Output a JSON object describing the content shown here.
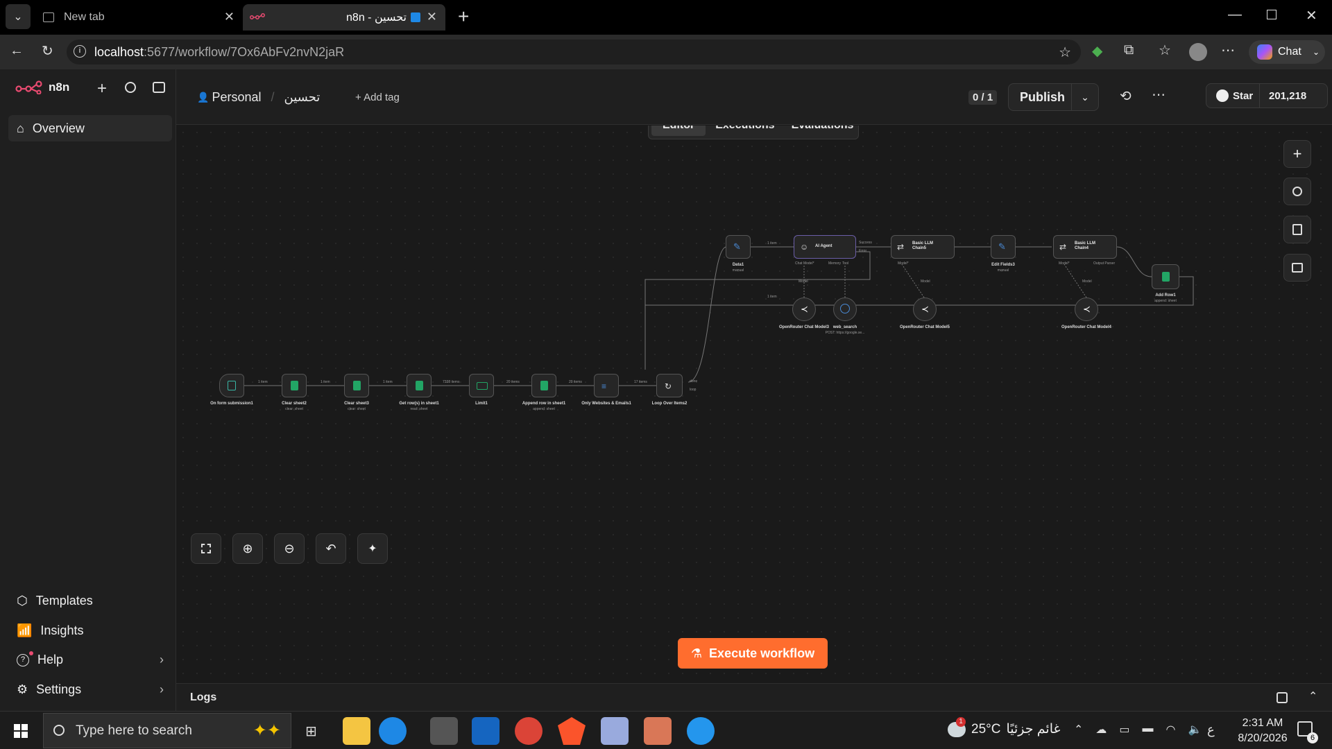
{
  "browser": {
    "tabs": [
      {
        "title": "New tab"
      },
      {
        "title": "n8n - تحسين"
      }
    ],
    "url_host": "localhost",
    "url_path": ":5677/workflow/7Ox6AbFv2nvN2jaR",
    "chat_label": "Chat"
  },
  "app": {
    "logo": "n8n",
    "nav": {
      "overview": "Overview",
      "templates": "Templates",
      "insights": "Insights",
      "help": "Help",
      "settings": "Settings"
    },
    "breadcrumb": {
      "project": "Personal",
      "workflow": "تحسين"
    },
    "add_tag": "+ Add tag",
    "version_counter": "0 / 1",
    "publish": "Publish",
    "star_label": "Star",
    "star_count": "201,218",
    "view_tabs": [
      "Editor",
      "Executions",
      "Evaluations"
    ],
    "active_view": "Editor",
    "execute_button": "Execute workflow",
    "logs_label": "Logs",
    "accent_color": "#ff6d2e"
  },
  "workflow": {
    "nodes": [
      {
        "id": "n1",
        "label": "On form submission1",
        "sub": "",
        "icon": "form-icon"
      },
      {
        "id": "n2",
        "label": "Clear sheet2",
        "sub": "clear: sheet",
        "icon": "sheets-icon"
      },
      {
        "id": "n3",
        "label": "Clear sheet3",
        "sub": "clear: sheet",
        "icon": "sheets-icon"
      },
      {
        "id": "n4",
        "label": "Get row(s) in sheet1",
        "sub": "read: sheet",
        "icon": "sheets-icon"
      },
      {
        "id": "n5",
        "label": "Limit1",
        "sub": "",
        "icon": "limit-icon"
      },
      {
        "id": "n6",
        "label": "Append row in sheet1",
        "sub": "append: sheet",
        "icon": "sheets-icon"
      },
      {
        "id": "n7",
        "label": "Only Websites & Emails1",
        "sub": "",
        "icon": "filter-icon"
      },
      {
        "id": "n8",
        "label": "Loop Over Items2",
        "sub": "",
        "icon": "loop-icon"
      },
      {
        "id": "n9",
        "label": "Data1",
        "sub": "manual",
        "icon": "edit-icon"
      },
      {
        "id": "n10",
        "label": "AI Agent",
        "sub": "",
        "icon": "robot-icon"
      },
      {
        "id": "n11",
        "label": "Basic LLM Chain5",
        "sub": "",
        "icon": "chain-icon"
      },
      {
        "id": "n12",
        "label": "Edit Fields3",
        "sub": "manual",
        "icon": "edit-icon"
      },
      {
        "id": "n13",
        "label": "Basic LLM Chain4",
        "sub": "",
        "icon": "chain-icon"
      },
      {
        "id": "n14",
        "label": "Add Row1",
        "sub": "append: sheet",
        "icon": "sheets-icon"
      },
      {
        "id": "n15",
        "label": "OpenRouter Chat Model3",
        "sub": "",
        "icon": "openrouter-icon"
      },
      {
        "id": "n16",
        "label": "web_search",
        "sub": "POST: https://google.se...",
        "icon": "globe-icon"
      },
      {
        "id": "n17",
        "label": "OpenRouter Chat Model5",
        "sub": "",
        "icon": "openrouter-icon"
      },
      {
        "id": "n18",
        "label": "OpenRouter Chat Model4",
        "sub": "",
        "icon": "openrouter-icon"
      }
    ],
    "edge_labels": [
      "1 item",
      "1 item",
      "1 item",
      "7338 items",
      "20 items",
      "20 items",
      "17 items",
      "1 item",
      "1 item"
    ],
    "port_labels": {
      "agent": [
        "Chat Model*",
        "Memory",
        "Tool"
      ],
      "chain5": [
        "Model*"
      ],
      "chain4": [
        "Model*",
        "Output Parser"
      ],
      "agent_out": [
        "Success",
        "Error"
      ],
      "loop_out": [
        "done",
        "loop"
      ],
      "model_link": "Model"
    }
  },
  "taskbar": {
    "search_placeholder": "Type here to search",
    "weather_temp": "25°C",
    "weather_text": "غائم جزئيًا",
    "lang": "ع",
    "time": "2:31 AM",
    "date": "8/20/2026",
    "notif_count": "6",
    "weather_badge": "1"
  }
}
